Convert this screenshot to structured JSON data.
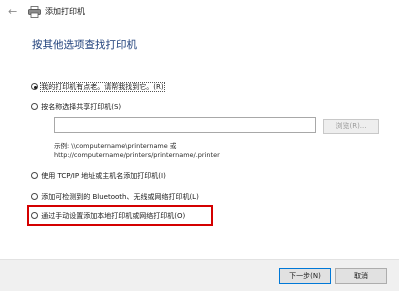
{
  "header": {
    "back_icon": "←",
    "window_title": "添加打印机"
  },
  "heading": "按其他选项查找打印机",
  "options": [
    {
      "label": "我的打印机有点老。请帮我找到它。(R)",
      "selected": true
    },
    {
      "label": "按名称选择共享打印机(S)",
      "selected": false
    },
    {
      "label": "使用 TCP/IP 地址或主机名添加打印机(I)",
      "selected": false
    },
    {
      "label": "添加可检测到的 Bluetooth、无线或网络打印机(L)",
      "selected": false
    },
    {
      "label": "通过手动设置添加本地打印机或网络打印机(O)",
      "selected": false
    }
  ],
  "share_input": {
    "value": "",
    "placeholder": ""
  },
  "browse_label": "浏览(R)...",
  "example": {
    "line1": "示例: \\\\computername\\printername 或",
    "line2": "http://computername/printers/printername/.printer"
  },
  "footer": {
    "next_label": "下一步(N)",
    "cancel_label": "取消"
  },
  "colors": {
    "heading": "#1e3f7a",
    "highlight": "#d40000",
    "footer_bg": "#f0f0f0"
  }
}
